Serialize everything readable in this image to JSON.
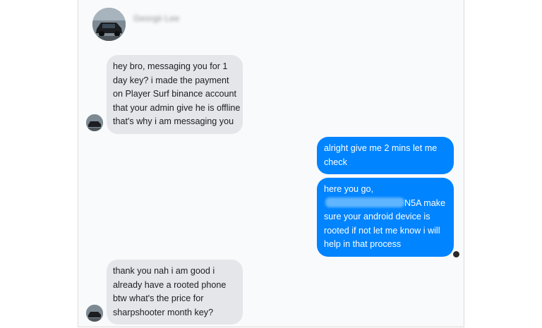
{
  "header": {
    "contact_name": "Georgii Lee",
    "avatar_icon": "car-avatar-icon"
  },
  "messages": [
    {
      "direction": "incoming",
      "lines": [
        "hey bro, messaging you for 1",
        "day key? i made the payment",
        "on Player Surf binance account",
        "that your admin give he is offline",
        "that's why i am messaging you"
      ]
    },
    {
      "direction": "outgoing",
      "lines": [
        "alright give me 2 mins let me",
        "check"
      ]
    },
    {
      "direction": "outgoing",
      "lines": [
        "here you go,",
        "N5A make",
        "sure your android device is",
        "rooted if not let me know i will",
        "help in that process"
      ]
    },
    {
      "direction": "incoming",
      "lines": [
        "thank you nah i am good i",
        "already have a rooted phone",
        "btw what's the price for",
        "sharpshooter month key?"
      ]
    }
  ],
  "colors": {
    "incoming_bubble": "#e4e6ea",
    "outgoing_bubble": "#0084ff",
    "panel_background": "#f9fafb"
  }
}
